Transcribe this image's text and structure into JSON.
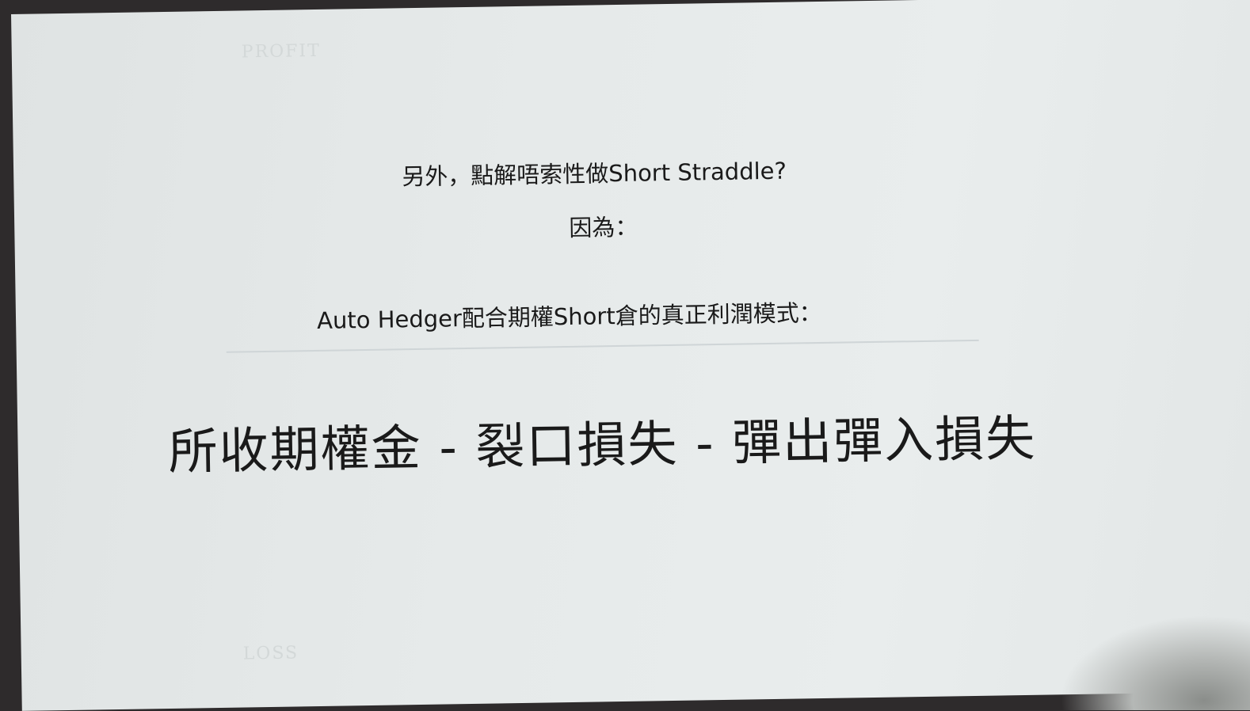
{
  "slide": {
    "question": "另外，點解唔索性做Short Straddle?",
    "because": "因為：",
    "subtitle": "Auto Hedger配合期權Short倉的真正利潤模式：",
    "formula": "所收期權金 - 裂口損失 - 彈出彈入損失",
    "ghost_profit": "PROFIT",
    "ghost_loss": "LOSS"
  }
}
